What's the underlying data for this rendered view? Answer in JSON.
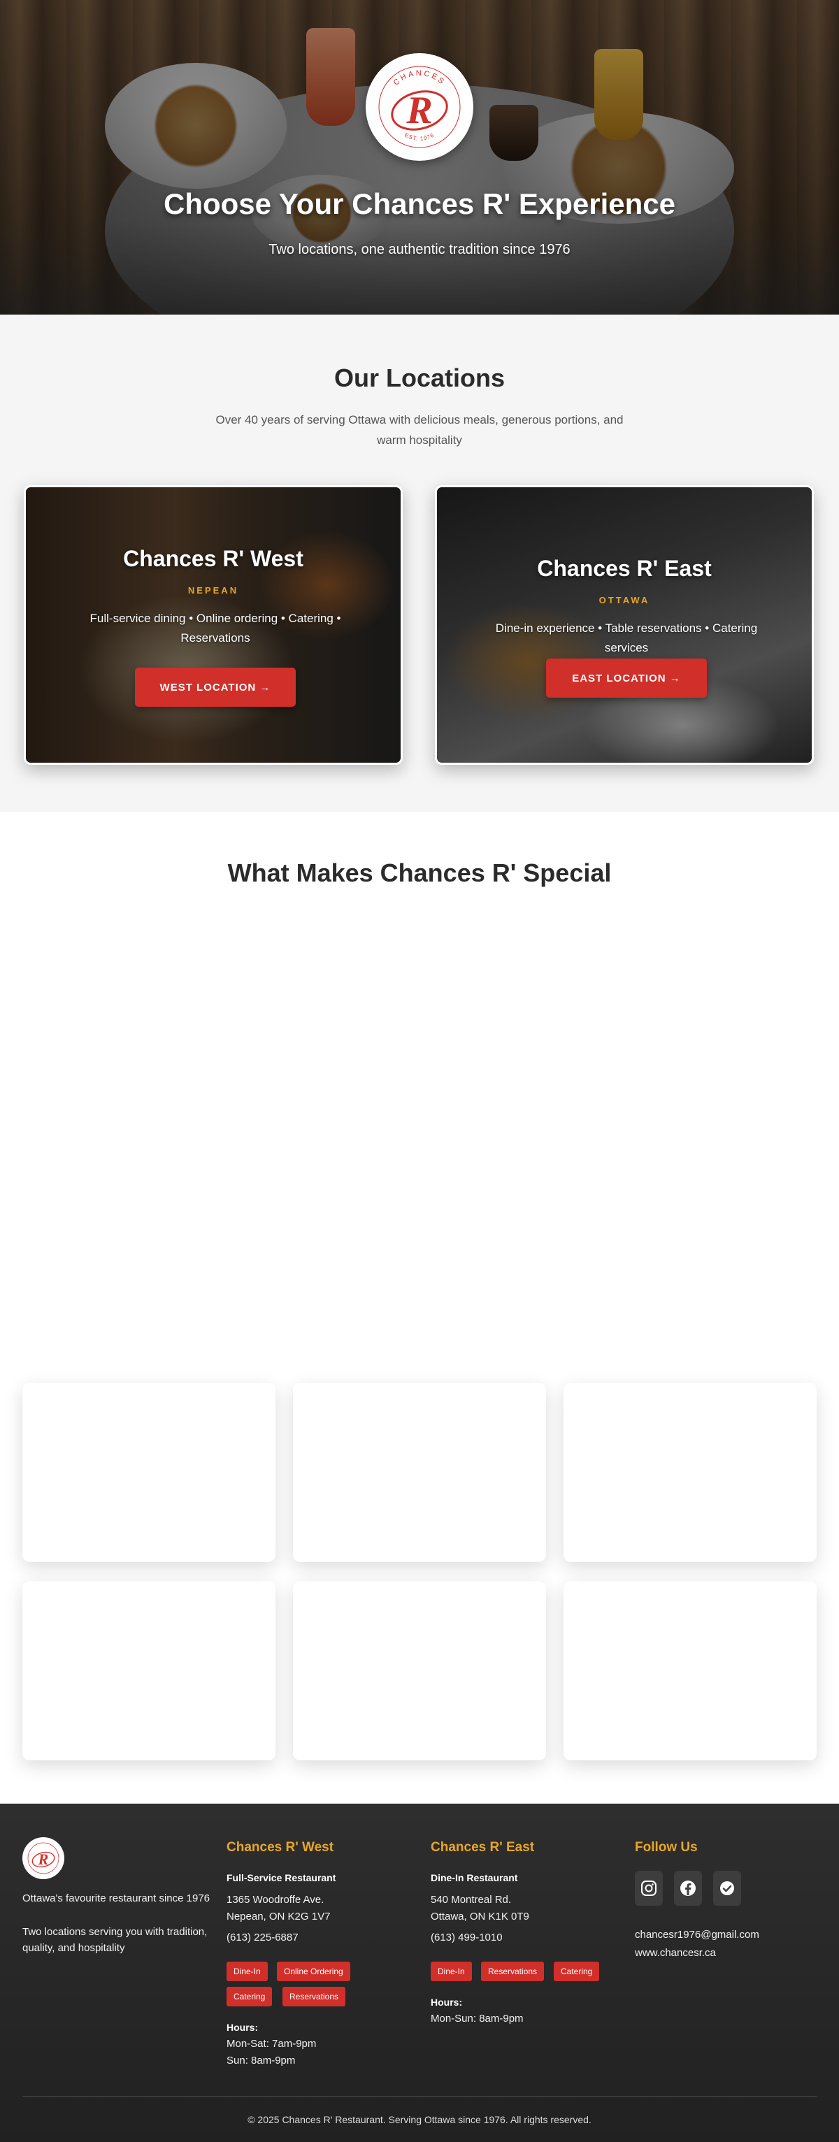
{
  "hero": {
    "logo_arc_text": "CHANCES",
    "logo_letter": "R",
    "logo_est": "EST. 1976",
    "title": "Choose Your Chances R' Experience",
    "subtitle": "Two locations, one authentic tradition since 1976"
  },
  "locations": {
    "title": "Our Locations",
    "description": "Over 40 years of serving Ottawa with delicious meals, generous portions, and warm hospitality",
    "cards": [
      {
        "title": "Chances R' West",
        "area": "NEPEAN",
        "description": "Full-service dining • Online ordering • Catering • Reservations",
        "button": "WEST LOCATION →"
      },
      {
        "title": "Chances R' East",
        "area": "OTTAWA",
        "description": "Dine-in experience • Table reservations • Catering services",
        "button": "EAST LOCATION →"
      }
    ]
  },
  "special": {
    "title": "What Makes Chances R' Special"
  },
  "footer": {
    "about": {
      "line1": "Ottawa's favourite restaurant since 1976",
      "line2": "Two locations serving you with tradition, quality, and hospitality"
    },
    "west": {
      "heading": "Chances R' West",
      "type": "Full-Service Restaurant",
      "address1": "1365 Woodroffe Ave.",
      "address2": "Nepean, ON K2G 1V7",
      "phone": "(613) 225-6887",
      "tags": [
        "Dine-In",
        "Online Ordering",
        "Catering",
        "Reservations"
      ],
      "hours_label": "Hours:",
      "hours1": "Mon-Sat: 7am-9pm",
      "hours2": "Sun: 8am-9pm"
    },
    "east": {
      "heading": "Chances R' East",
      "type": "Dine-In Restaurant",
      "address1": "540 Montreal Rd.",
      "address2": "Ottawa, ON K1K 0T9",
      "phone": "(613) 499-1010",
      "tags": [
        "Dine-In",
        "Reservations",
        "Catering"
      ],
      "hours_label": "Hours:",
      "hours1": "Mon-Sun: 8am-9pm"
    },
    "follow": {
      "heading": "Follow Us",
      "icons": [
        "instagram-icon",
        "facebook-icon",
        "verified-icon"
      ],
      "email": "chancesr1976@gmail.com",
      "website": "www.chancesr.ca"
    },
    "copyright": "© 2025 Chances R' Restaurant. Serving Ottawa since 1976. All rights reserved."
  },
  "colors": {
    "brand_red": "#d12f2a",
    "accent_gold": "#e8a628",
    "footer_bg": "#262626"
  }
}
